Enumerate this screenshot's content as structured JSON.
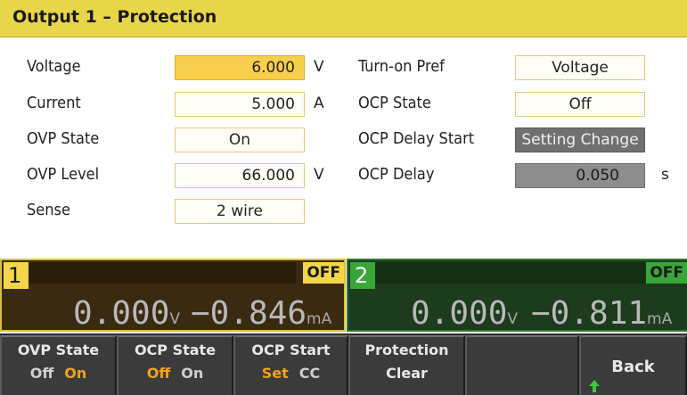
{
  "title": "Output 1 – Protection",
  "left_rows": [
    {
      "label": "Voltage",
      "value": "6.000",
      "unit": "V"
    },
    {
      "label": "Current",
      "value": "5.000",
      "unit": "A"
    },
    {
      "label": "OVP State",
      "value": "On",
      "unit": ""
    },
    {
      "label": "OVP Level",
      "value": "66.000",
      "unit": "V"
    },
    {
      "label": "Sense",
      "value": "2 wire",
      "unit": ""
    }
  ],
  "right_rows": [
    {
      "label": "Turn-on Pref",
      "value": "Voltage",
      "unit": ""
    },
    {
      "label": "OCP State",
      "value": "Off",
      "unit": ""
    },
    {
      "label": "OCP Delay Start",
      "value": "Setting Change",
      "unit": ""
    },
    {
      "label": "OCP Delay",
      "value": "0.050",
      "unit": "s"
    }
  ],
  "channels": [
    {
      "number": "1",
      "status": "OFF",
      "voltage": "0.000",
      "voltage_unit": "V",
      "current": "−0.846",
      "current_unit": "mA"
    },
    {
      "number": "2",
      "status": "OFF",
      "voltage": "0.000",
      "voltage_unit": "V",
      "current": "−0.811",
      "current_unit": "mA"
    }
  ],
  "softkeys": [
    {
      "label": "OVP State",
      "options": [
        "Off",
        "On"
      ],
      "selected": "On"
    },
    {
      "label": "OCP State",
      "options": [
        "Off",
        "On"
      ],
      "selected": "Off"
    },
    {
      "label": "OCP Start",
      "options": [
        "Set",
        "CC"
      ],
      "selected": "Set"
    },
    {
      "label": "Protection",
      "sub": "Clear"
    },
    {
      "label": ""
    },
    {
      "label": "Back"
    }
  ],
  "colors": {
    "title_bar": "#e8d64a",
    "active_field": "#f7cf4d",
    "selected_option": "#f0a21e",
    "channel1": "#f3d64a",
    "channel2": "#3aa63a"
  }
}
